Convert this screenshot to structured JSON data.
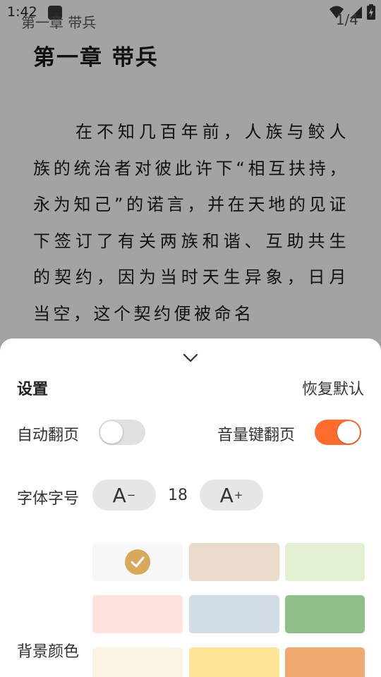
{
  "status_bar": {
    "time": "1:42"
  },
  "reader": {
    "running_chapter": "第一章 带兵",
    "page_indicator": "1/4",
    "chapter_title": "第一章 带兵",
    "body_text": "在不知几百年前，人族与鲛人族的统治者对彼此许下“相互扶持，永为知己”的诺言，并在天地的见证下签订了有关两族和谐、互助共生的契约，因为当时天生异象，日月当空，这个契约便被命名"
  },
  "settings": {
    "title": "设置",
    "reset_label": "恢复默认",
    "auto_page_label": "自动翻页",
    "auto_page_on": false,
    "volume_key_label": "音量键翻页",
    "volume_key_on": true,
    "font_size_label": "字体字号",
    "font_decrease_label": "A",
    "font_increase_label": "A",
    "font_size_value": "18",
    "background_label": "背景颜色",
    "accent_color": "#ff6d2e",
    "check_color": "#d9a95b",
    "background_colors": [
      "#f7f7f7",
      "#eadbcb",
      "#e3efd2",
      "#fde3dc",
      "#d1dce6",
      "#8fc08a",
      "#fbf3e4",
      "#fde596",
      "#f2a871"
    ],
    "selected_background_index": 0
  }
}
